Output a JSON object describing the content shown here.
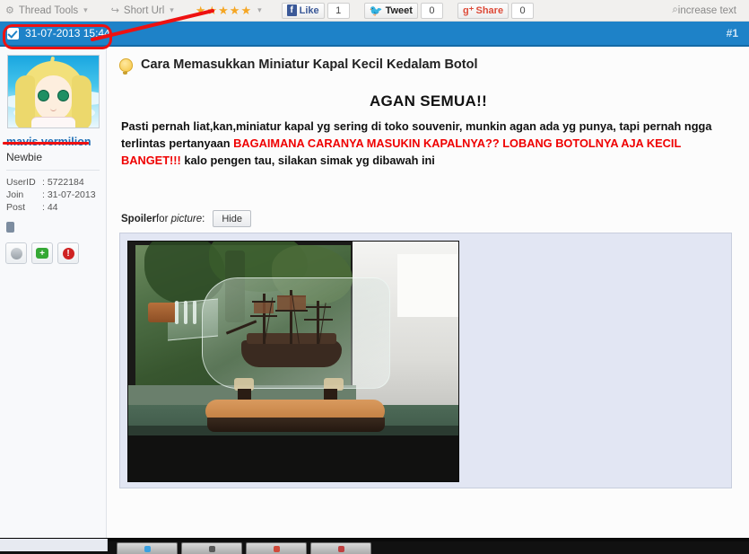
{
  "toolbar": {
    "thread_tools": "Thread Tools",
    "short_url": "Short Url",
    "rating_stars": 5,
    "star_glyph": "★",
    "caret_glyph": "▾",
    "facebook": {
      "label": "Like",
      "count": "1",
      "icon": "f"
    },
    "twitter": {
      "label": "Tweet",
      "count": "0",
      "icon": "twitter-bird"
    },
    "gplus": {
      "label": "Share",
      "count": "0",
      "icon": "g-plus"
    },
    "increase_text": "increase text",
    "search_glyph": "⌕",
    "gear_glyph": "⚙",
    "link_glyph": "↪"
  },
  "postbar": {
    "date": "31-07-2013 15:44",
    "post_number": "#1"
  },
  "sidebar": {
    "username": "mavis.vermilion",
    "usertitle": "Newbie",
    "stats": [
      {
        "label": "UserID",
        "sep": ":",
        "value": "5722184"
      },
      {
        "label": "Join",
        "sep": ":",
        "value": "31-07-2013"
      },
      {
        "label": "Post",
        "sep": ":",
        "value": "44"
      }
    ],
    "buttons": [
      {
        "name": "offline-status",
        "glyph": ""
      },
      {
        "name": "reputation-add",
        "glyph": "+"
      },
      {
        "name": "report-post",
        "glyph": "!"
      }
    ]
  },
  "content": {
    "thread_title": "Cara Memasukkan Miniatur Kapal Kecil Kedalam Botol",
    "heading": "AGAN SEMUA!!",
    "paragraph_part1": "Pasti pernah liat,kan,miniatur kapal yg sering di toko souvenir, munkin agan ada yg punya, tapi pernah ngga terlintas pertanyaan ",
    "paragraph_red": "BAGAIMANA CARANYA MASUKIN KAPALNYA?? LOBANG BOTOLNYA AJA KECIL BANGET!!!",
    "paragraph_part2": " kalo pengen tau, silakan simak yg dibawah ini",
    "spoiler_bold": "Spoiler",
    "spoiler_for": "for",
    "spoiler_kind": "picture",
    "spoiler_colon": ":",
    "hide_button": "Hide",
    "image_alt": "ship-in-a-bottle-photo"
  },
  "colors": {
    "postbar_blue": "#1e82c8",
    "annotation_red": "#ee1111",
    "body_red": "#ef0000",
    "star_orange": "#f5a623",
    "username_blue": "#1e6fb5",
    "spoiler_bg": "#e2e6f3"
  }
}
